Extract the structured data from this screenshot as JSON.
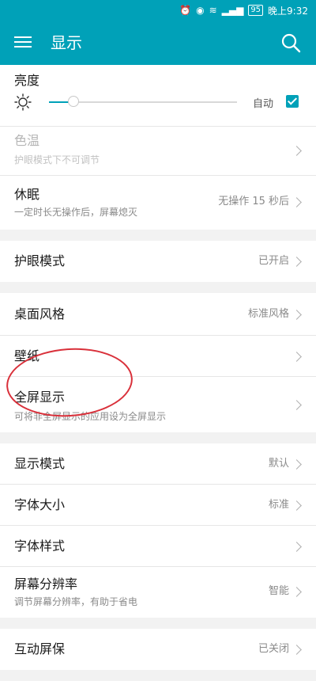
{
  "status_bar": {
    "battery": "95",
    "time": "晚上9:32"
  },
  "toolbar": {
    "title": "显示"
  },
  "brightness": {
    "label": "亮度",
    "auto_label": "自动",
    "auto_checked": true,
    "level": 0.13
  },
  "color_temp": {
    "label": "色温",
    "subtitle": "护眼模式下不可调节"
  },
  "sleep": {
    "label": "休眠",
    "subtitle": "一定时长无操作后，屏幕熄灭",
    "value": "无操作 15 秒后"
  },
  "eye_care": {
    "label": "护眼模式",
    "value": "已开启"
  },
  "home_style": {
    "label": "桌面风格",
    "value": "标准风格"
  },
  "wallpaper": {
    "label": "壁纸"
  },
  "fullscreen": {
    "label": "全屏显示",
    "subtitle": "可将非全屏显示的应用设为全屏显示"
  },
  "display_mode": {
    "label": "显示模式",
    "value": "默认"
  },
  "font_size": {
    "label": "字体大小",
    "value": "标准"
  },
  "font_style": {
    "label": "字体样式"
  },
  "resolution": {
    "label": "屏幕分辨率",
    "subtitle": "调节屏幕分辨率，有助于省电",
    "value": "智能"
  },
  "screensaver": {
    "label": "互动屏保",
    "value": "已关闭"
  },
  "colors": {
    "accent": "#00a1b8",
    "annotation": "#d9303a"
  }
}
